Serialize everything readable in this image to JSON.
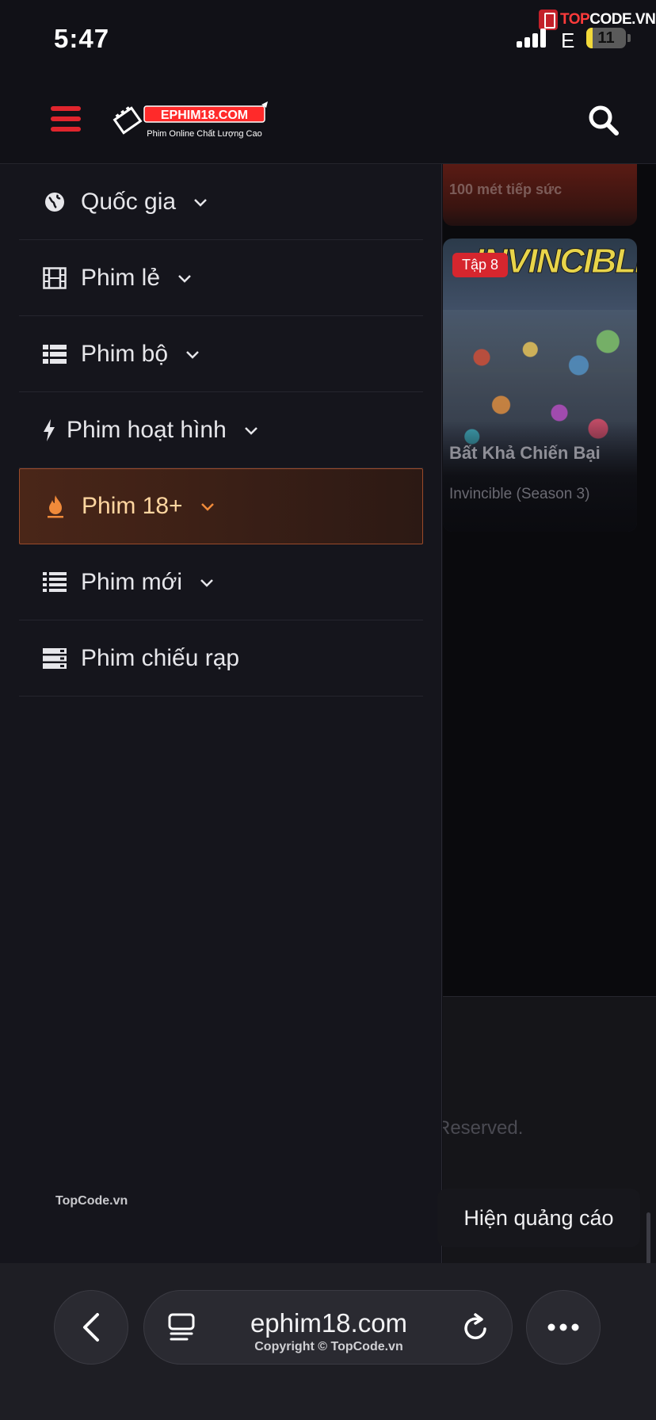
{
  "status_bar": {
    "time": "5:47",
    "network": "E",
    "battery": "11",
    "battery_level": 0.11,
    "watermark_prefix": "TOP",
    "watermark_suffix": "CODE.VN"
  },
  "header": {
    "logo_title": "EPHIM18.COM",
    "logo_tagline": "Phim Online Chất Lượng Cao",
    "menu_icon": "hamburger-icon",
    "search_icon": "search-icon"
  },
  "drawer": {
    "items": [
      {
        "label": "Quốc gia",
        "icon": "globe-icon",
        "has_dropdown": true,
        "active": false
      },
      {
        "label": "Phim lẻ",
        "icon": "film-icon",
        "has_dropdown": true,
        "active": false
      },
      {
        "label": "Phim bộ",
        "icon": "list-icon",
        "has_dropdown": true,
        "active": false
      },
      {
        "label": "Phim hoạt hình",
        "icon": "bolt-icon",
        "has_dropdown": true,
        "active": false
      },
      {
        "label": "Phim 18+",
        "icon": "fire-icon",
        "has_dropdown": true,
        "active": true
      },
      {
        "label": "Phim mới",
        "icon": "list-lines-icon",
        "has_dropdown": true,
        "active": false
      },
      {
        "label": "Phim chiếu rạp",
        "icon": "server-icon",
        "has_dropdown": false,
        "active": false
      }
    ],
    "footer": "TopCode.vn",
    "accent_color": "#e0252d",
    "active_color": "#f08a3a"
  },
  "background_page": {
    "top_card_text": "100 mét tiếp sức",
    "card": {
      "badge": "Tập 8",
      "poster_title": "INVINCIBLE",
      "title": "Bất Khả Chiến Bại",
      "subtitle": "Invincible (Season 3)"
    },
    "footer_text": "Reserved."
  },
  "ad_tooltip": "Hiện quảng cáo",
  "browser": {
    "url": "ephim18.com",
    "copyright": "Copyright © TopCode.vn"
  }
}
